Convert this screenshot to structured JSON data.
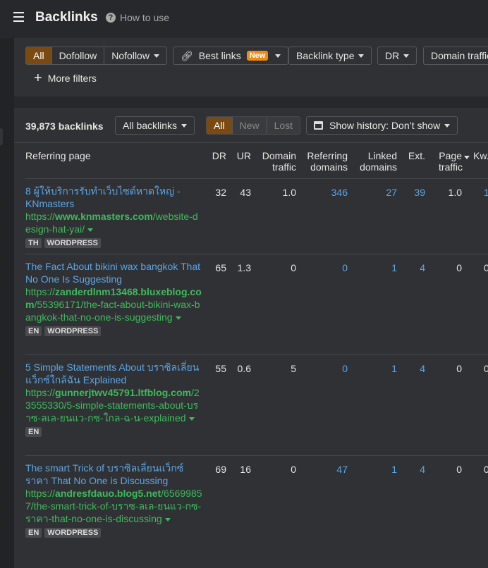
{
  "header": {
    "title": "Backlinks",
    "help": "How to use"
  },
  "filters": {
    "link_type": [
      "All",
      "Dofollow",
      "Nofollow"
    ],
    "best_links": "Best links",
    "new_badge": "New",
    "backlink_type": "Backlink type",
    "dr": "DR",
    "domain_traffic": "Domain traffic",
    "more_filters": "More filters"
  },
  "toolbar": {
    "count": "39,873 backlinks",
    "scope": "All backlinks",
    "status": [
      "All",
      "New",
      "Lost"
    ],
    "history": "Show history: Don’t show"
  },
  "columns": {
    "referring_page": "Referring page",
    "dr": "DR",
    "ur": "UR",
    "domain_traffic_1": "Domain",
    "domain_traffic_2": "traffic",
    "ref_domains_1": "Referring",
    "ref_domains_2": "domains",
    "linked_1": "Linked",
    "linked_2": "domains",
    "ext": "Ext.",
    "page_traffic_1": "Page",
    "page_traffic_2": "traffic",
    "kw": "Kw."
  },
  "rows": [
    {
      "title": "8 ผู้ให้บริการรับทำเว็บไซต์หาดใหญ่ - KNmasters",
      "url_pre": "https://",
      "url_domain": "www.knmasters.com",
      "url_path": "/website-design-hat-yai/",
      "tags": [
        "TH",
        "WORDPRESS"
      ],
      "dr": "32",
      "ur": "43",
      "domain_traffic": "1.0",
      "ref_domains": "346",
      "linked_domains": "27",
      "ext": "39",
      "page_traffic": "1.0",
      "kw": "1"
    },
    {
      "title": "The Fact About bikini wax bangkok That No One Is Suggesting",
      "url_pre": "https://",
      "url_domain": "zanderdlnm13468.bluxeblog.com",
      "url_path": "/55396171/the-fact-about-bikini-wax-bangkok-that-no-one-is-suggesting",
      "tags": [
        "EN",
        "WORDPRESS"
      ],
      "dr": "65",
      "ur": "1.3",
      "domain_traffic": "0",
      "ref_domains": "0",
      "linked_domains": "1",
      "ext": "4",
      "page_traffic": "0",
      "kw": "0"
    },
    {
      "title": "5 Simple Statements About บราซิลเลี่ยนแว็กซ์ใกล้ฉัน Explained",
      "url_pre": "https://",
      "url_domain": "gunnerjtwv45791.ltfblog.com",
      "url_path": "/23555330/5-simple-statements-about-บราซ-ลเล-ยนแว-กซ-ใกล-ฉ-น-explained",
      "tags": [
        "EN"
      ],
      "dr": "55",
      "ur": "0.6",
      "domain_traffic": "5",
      "ref_domains": "0",
      "linked_domains": "1",
      "ext": "4",
      "page_traffic": "0",
      "kw": "0"
    },
    {
      "title": "The smart Trick of บราซิลเลี่ยนแว็กซ์ราคา That No One is Discussing",
      "url_pre": "https://",
      "url_domain": "andresfdauo.blog5.net",
      "url_path": "/65699857/the-smart-trick-of-บราซ-ลเล-ยนแว-กซ-ราคา-that-no-one-is-discussing",
      "tags": [
        "EN",
        "WORDPRESS"
      ],
      "dr": "69",
      "ur": "16",
      "domain_traffic": "0",
      "ref_domains": "47",
      "linked_domains": "1",
      "ext": "4",
      "page_traffic": "0",
      "kw": "0"
    }
  ],
  "colors": {
    "accent": "#7a4a12",
    "badge": "#f28a10",
    "link": "#5aa6e8",
    "url": "#3dbb5c"
  }
}
